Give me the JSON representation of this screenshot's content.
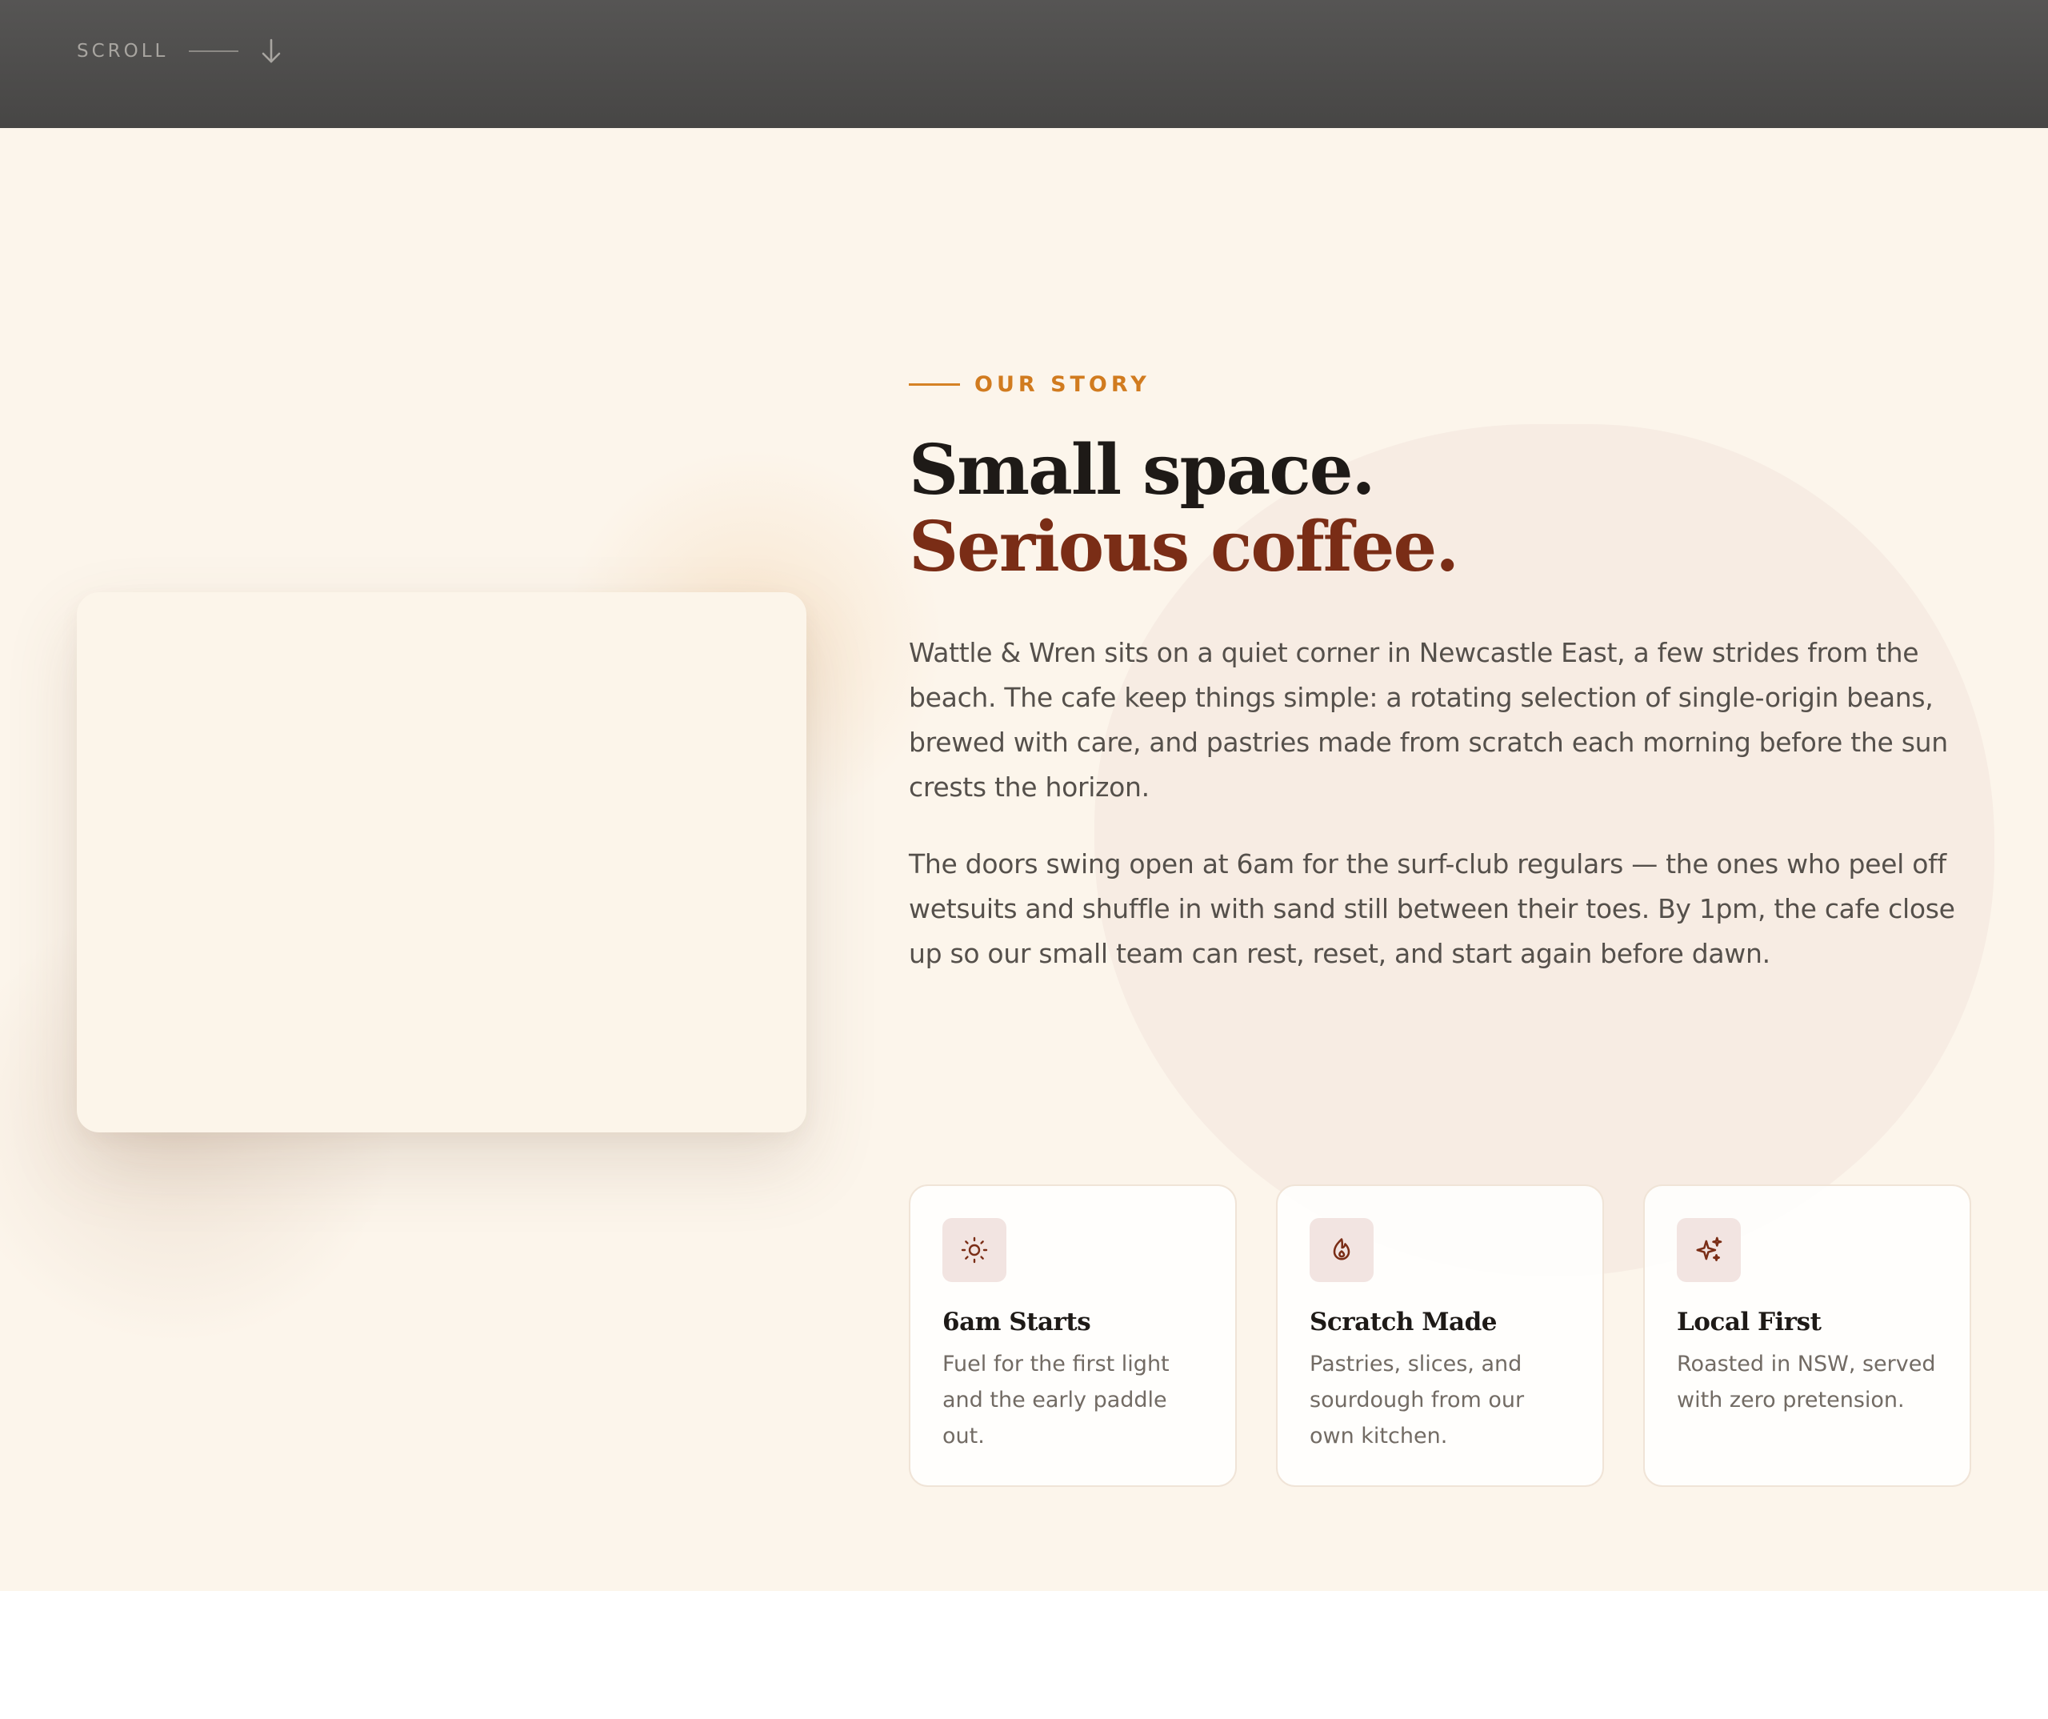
{
  "scroll_indicator": {
    "label": "SCROLL",
    "icon": "arrow-down-icon"
  },
  "story": {
    "eyebrow": "OUR STORY",
    "headline_line1": "Small space.",
    "headline_line2": "Serious coffee.",
    "paragraphs": [
      "Wattle & Wren sits on a quiet corner in Newcastle East, a few strides from the beach. The cafe keep things simple: a rotating selection of single-origin beans, brewed with care, and pastries made from scratch each morning before the sun crests the horizon.",
      "The doors swing open at 6am for the surf-club regulars — the ones who peel off wetsuits and shuffle in with sand still between their toes. By 1pm, the cafe close up so our small team can rest, reset, and start again before dawn."
    ],
    "features": [
      {
        "icon": "sun-icon",
        "title": "6am Starts",
        "text": "Fuel for the first light and the early paddle out."
      },
      {
        "icon": "flame-icon",
        "title": "Scratch Made",
        "text": "Pastries, slices, and sourdough from our own kitchen."
      },
      {
        "icon": "sparkles-icon",
        "title": "Local First",
        "text": "Roasted in NSW, served with zero pretension."
      }
    ]
  },
  "colors": {
    "accent_orange": "#d17b1f",
    "accent_brown": "#7a2d16",
    "section_background": "#fcf5eb",
    "top_band": "#4d4c4b"
  }
}
